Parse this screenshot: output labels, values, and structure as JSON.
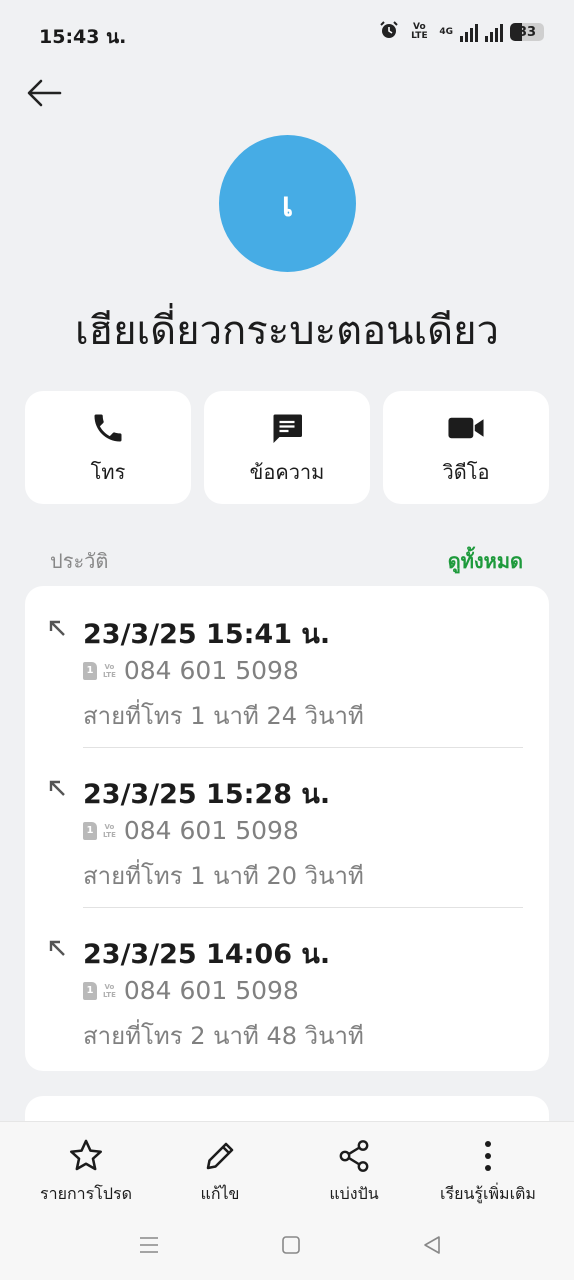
{
  "status_bar": {
    "time": "15:43 น.",
    "network_volte": "Vo LTE",
    "network_4g": "4G",
    "battery": "33",
    "icons": [
      "alarm-icon",
      "volte-icon",
      "signal-icon",
      "signal-icon",
      "battery-icon"
    ]
  },
  "header": {
    "back_icon": "arrow-left-icon"
  },
  "contact": {
    "avatar_initial": "เ",
    "avatar_color": "#46ace5",
    "name": "เฮียเดี่ยวกระบะตอนเดียว"
  },
  "actions": [
    {
      "label": "โทร",
      "icon": "phone-icon"
    },
    {
      "label": "ข้อความ",
      "icon": "message-icon"
    },
    {
      "label": "วิดีโอ",
      "icon": "video-icon"
    }
  ],
  "history": {
    "title": "ประวัติ",
    "see_all": "ดูทั้งหมด",
    "accent": "#1e9a3c",
    "calls": [
      {
        "datetime": "23/3/25 15:41 น.",
        "sim": "1",
        "number": "084 601 5098",
        "duration": "สายที่โทร  1 นาที 24 วินาที"
      },
      {
        "datetime": "23/3/25 15:28 น.",
        "sim": "1",
        "number": "084 601 5098",
        "duration": "สายที่โทร  1 นาที 20 วินาที"
      },
      {
        "datetime": "23/3/25 14:06 น.",
        "sim": "1",
        "number": "084 601 5098",
        "duration": "สายที่โทร  2 นาที 48 วินาที"
      }
    ]
  },
  "toolbar": [
    {
      "label": "รายการโปรด",
      "icon": "star-icon"
    },
    {
      "label": "แก้ไข",
      "icon": "pencil-icon"
    },
    {
      "label": "แบ่งปัน",
      "icon": "share-icon"
    },
    {
      "label": "เรียนรู้เพิ่มเติม",
      "icon": "more-vertical-icon"
    }
  ],
  "nav": [
    "menu-icon",
    "home-icon",
    "back-icon"
  ]
}
